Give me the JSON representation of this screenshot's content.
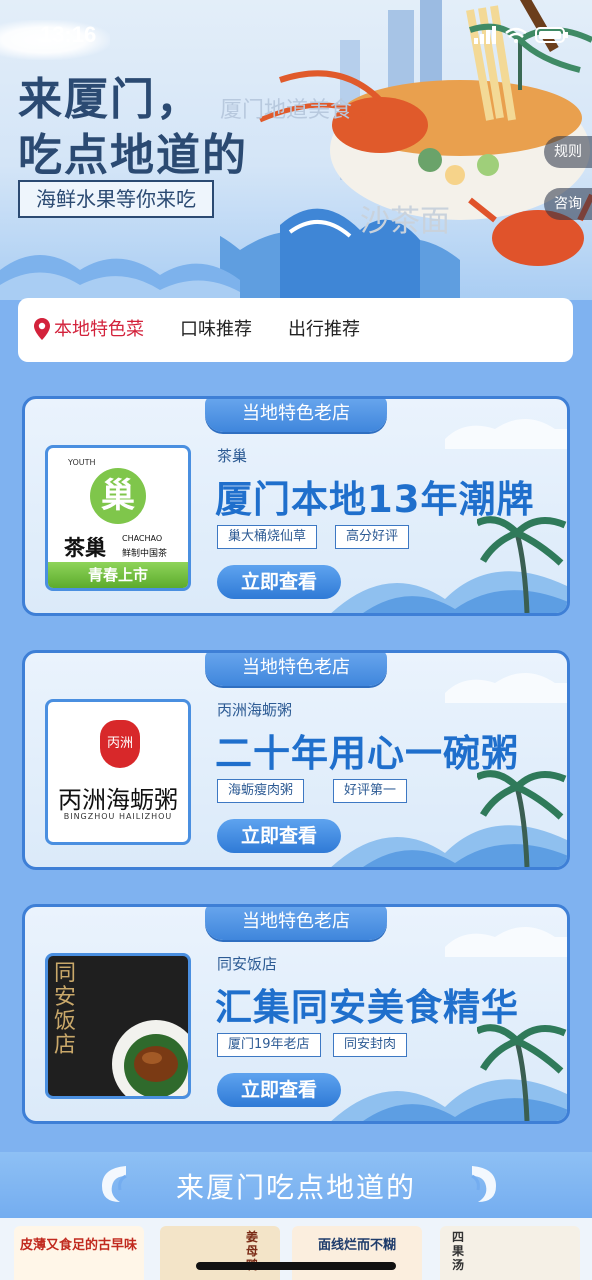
{
  "status": {
    "time": "13:16"
  },
  "hero": {
    "title_line1": "来厦门，",
    "title_line2": "吃点地道的",
    "subtitle": "海鲜水果等你来吃",
    "faded_text": "厦门地道美食",
    "bowl_text": "沙茶面",
    "rules_label": "规则",
    "consult_label": "咨询"
  },
  "tabs": [
    {
      "label": "本地特色菜",
      "active": true
    },
    {
      "label": "口味推荐",
      "active": false
    },
    {
      "label": "出行推荐",
      "active": false
    }
  ],
  "shops": [
    {
      "section_label": "当地特色老店",
      "name": "茶巢",
      "slogan": "厦门本地13年潮牌",
      "tags": [
        "巢大桶烧仙草",
        "高分好评"
      ],
      "button": "立即查看",
      "logo": {
        "badge": "YOUTH",
        "mark": "巢",
        "brand": "茶巢",
        "brand_en": "CHACHAO",
        "brand_sub": "鲜制中国茶",
        "footer": "青春上市"
      }
    },
    {
      "section_label": "当地特色老店",
      "name": "丙洲海蛎粥",
      "slogan": "二十年用心一碗粥",
      "tags": [
        "海蛎瘦肉粥",
        "好评第一"
      ],
      "button": "立即查看",
      "logo": {
        "seal": "丙洲",
        "brand": "丙洲海蛎粥",
        "brand_en": "BINGZHOU HAILIZHOU"
      }
    },
    {
      "section_label": "当地特色老店",
      "name": "同安饭店",
      "slogan": "汇集同安美食精华",
      "tags": [
        "厦门19年老店",
        "同安封肉"
      ],
      "button": "立即查看",
      "logo": {
        "brand": "同安饭店"
      }
    }
  ],
  "footer": {
    "title": "来厦门吃点地道的",
    "tiles": [
      "皮薄又食足的古早味",
      "姜母鸭",
      "面线烂而不糊",
      "四果汤"
    ]
  },
  "colors": {
    "page_bg": "#7fb2f0",
    "accent_blue": "#1f6fcc",
    "active_tab": "#d3223b",
    "card_border": "#3e7fd6"
  }
}
